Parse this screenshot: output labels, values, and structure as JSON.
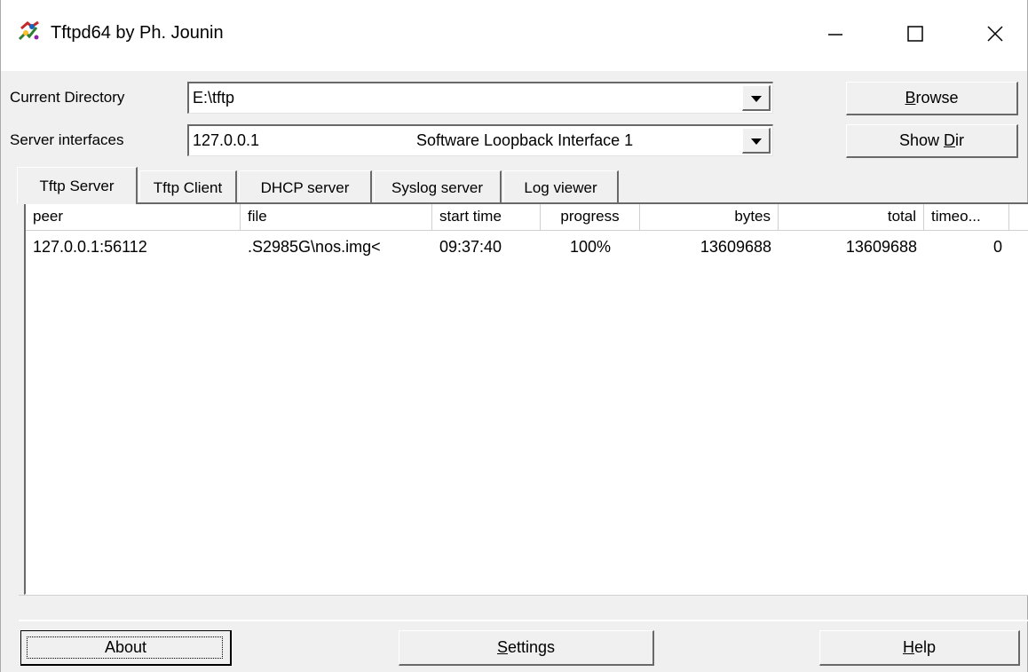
{
  "window": {
    "title": "Tftpd64 by Ph. Jounin",
    "app_icon": "tftpd-icon",
    "controls": {
      "minimize": "minimize-icon",
      "maximize": "maximize-icon",
      "close": "close-icon"
    }
  },
  "current_directory": {
    "label": "Current Directory",
    "value": "E:\\tftp"
  },
  "server_interfaces": {
    "label": "Server interfaces",
    "ip": "127.0.0.1",
    "name": "Software Loopback Interface 1"
  },
  "buttons": {
    "browse_pre": "",
    "browse_key": "B",
    "browse_post": "rowse",
    "showdir_pre": "Show ",
    "showdir_key": "D",
    "showdir_post": "ir",
    "about": "About",
    "settings_pre": "",
    "settings_key": "S",
    "settings_post": "ettings",
    "help_pre": "",
    "help_key": "H",
    "help_post": "elp"
  },
  "tabs": [
    {
      "label": "Tftp Server",
      "active": true
    },
    {
      "label": "Tftp Client",
      "active": false
    },
    {
      "label": "DHCP server",
      "active": false
    },
    {
      "label": "Syslog server",
      "active": false
    },
    {
      "label": "Log viewer",
      "active": false
    }
  ],
  "table": {
    "columns": [
      "peer",
      "file",
      "start time",
      "progress",
      "bytes",
      "total",
      "timeo..."
    ],
    "rows": [
      {
        "peer": "127.0.0.1:56112",
        "file": ".S2985G\\nos.img<",
        "start_time": "09:37:40",
        "progress": "100%",
        "bytes": "13609688",
        "total": "13609688",
        "timeout": "0"
      }
    ]
  }
}
